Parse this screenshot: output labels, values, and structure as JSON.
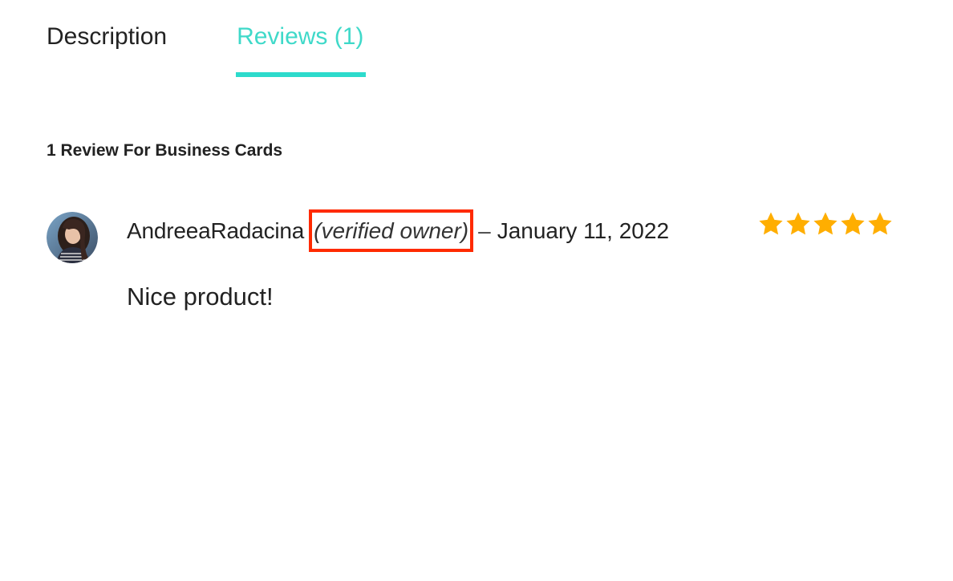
{
  "tabs": {
    "description": "Description",
    "reviews": "Reviews (1)"
  },
  "reviews_section": {
    "heading": "1 Review For Business Cards",
    "review": {
      "author": "AndreeaRadacina",
      "verified_label": "(verified owner)",
      "separator": "–",
      "date": "January 11, 2022",
      "rating": 5,
      "rating_max": 5,
      "text": "Nice product!",
      "avatar_icon": "user-avatar-photo"
    }
  },
  "colors": {
    "accent": "#2ddbcc",
    "star": "#ffae00",
    "highlight_box": "#ff2a00"
  }
}
